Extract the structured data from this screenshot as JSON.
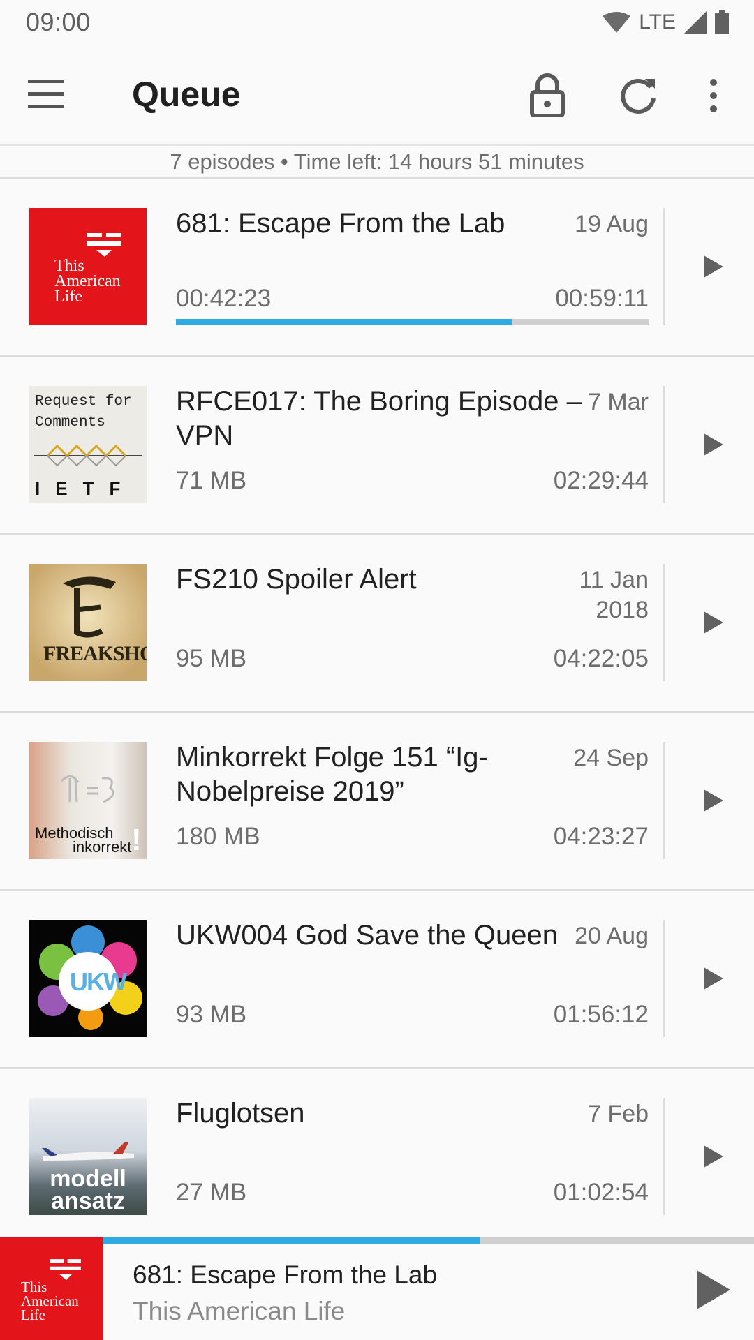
{
  "status_bar": {
    "time": "09:00",
    "network": "LTE"
  },
  "toolbar": {
    "title": "Queue"
  },
  "summary": "7 episodes • Time left: 14 hours 51 minutes",
  "colors": {
    "accent": "#2eabe0",
    "tal_red": "#e4141b"
  },
  "episodes": [
    {
      "title": "681: Escape From the Lab",
      "date": "19 Aug",
      "position": "00:42:23",
      "duration": "00:59:11",
      "progress": 0.71,
      "cover_text": "This American Life"
    },
    {
      "title": "RFCE017: The Boring Episode – VPN",
      "date": "7 Mar",
      "size": "71 MB",
      "duration": "02:29:44",
      "cover_text_top": "Request for Comments",
      "cover_text_bottom": "IETF"
    },
    {
      "title": "FS210 Spoiler Alert",
      "date": "11 Jan 2018",
      "size": "95 MB",
      "duration": "04:22:05",
      "cover_text": "FREAKSHOW"
    },
    {
      "title": "Minkorrekt Folge 151 “Ig-Nobelpreise 2019”",
      "date": "24 Sep",
      "size": "180 MB",
      "duration": "04:23:27",
      "cover_text_a": "Methodisch",
      "cover_text_b": "inkorrekt",
      "cover_text_c": "!"
    },
    {
      "title": "UKW004 God Save the Queen",
      "date": "20 Aug",
      "size": "93 MB",
      "duration": "01:56:12",
      "cover_text": "UKW"
    },
    {
      "title": "Fluglotsen",
      "date": "7 Feb",
      "size": "27 MB",
      "duration": "01:02:54",
      "cover_text": "modell ansatz"
    }
  ],
  "player": {
    "title": "681: Escape From the Lab",
    "podcast": "This American Life",
    "progress": 0.58,
    "cover_text": "This American Life"
  }
}
